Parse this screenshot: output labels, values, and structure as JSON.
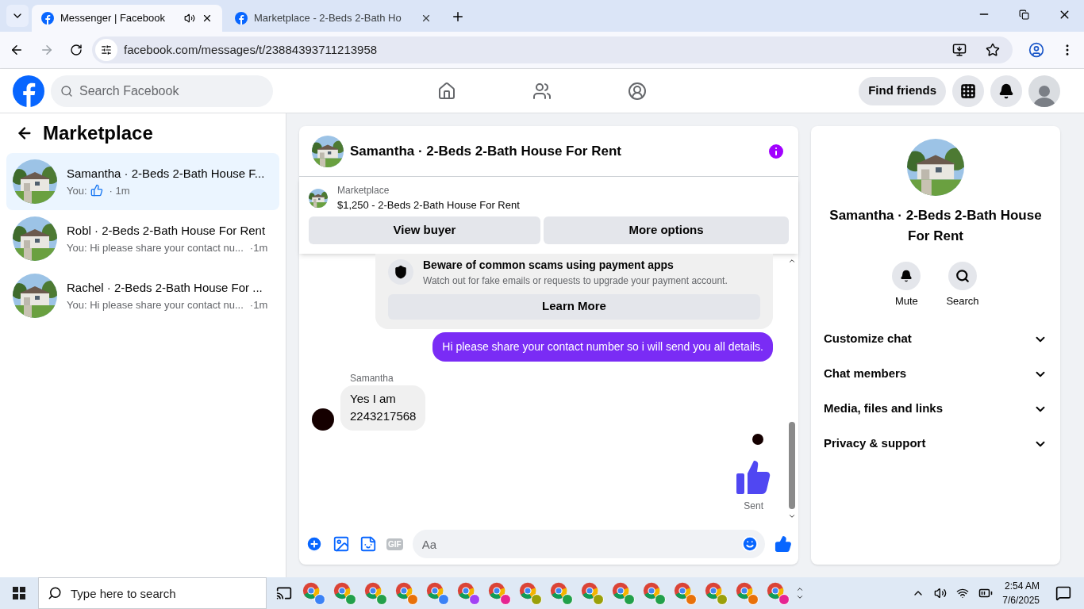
{
  "browser": {
    "tabs": [
      {
        "title": "Messenger | Facebook",
        "selected": true,
        "audio": true
      },
      {
        "title": "Marketplace - 2-Beds 2-Bath Ho",
        "selected": false,
        "audio": false
      }
    ],
    "url": "facebook.com/messages/t/23884393711213958"
  },
  "header": {
    "search_placeholder": "Search Facebook",
    "find_friends": "Find friends"
  },
  "sidebar": {
    "title": "Marketplace",
    "chats": [
      {
        "name": "Samantha · 2-Beds 2-Bath House F...",
        "preview": "You:",
        "time": "· 1m",
        "kind": "like",
        "selected": true
      },
      {
        "name": "Robl · 2-Beds 2-Bath House For Rent",
        "preview": "You: Hi please share your contact nu...",
        "time": "·1m",
        "kind": "text",
        "selected": false
      },
      {
        "name": "Rachel · 2-Beds 2-Bath House For ...",
        "preview": "You: Hi please share your contact nu...",
        "time": "·1m",
        "kind": "text",
        "selected": false
      }
    ]
  },
  "chat": {
    "title": "Samantha · 2-Beds 2-Bath House For Rent",
    "listing": {
      "label": "Marketplace",
      "title": "$1,250 - 2-Beds 2-Bath House For Rent"
    },
    "buttons": [
      "View buyer",
      "More options"
    ],
    "notice": {
      "title": "Beware of common scams using payment apps",
      "text": "Watch out for fake emails or requests to upgrade your payment account.",
      "button": "Learn More"
    },
    "messages": [
      {
        "kind": "sent_text",
        "text": "Hi please share your contact number so i will send you all details."
      },
      {
        "kind": "received_text",
        "sender": "Samantha",
        "text": "Yes I am\n2243217568"
      },
      {
        "kind": "sent_like",
        "status": "Sent"
      }
    ],
    "composer": {
      "placeholder": "Aa",
      "gif": "GIF"
    }
  },
  "details": {
    "title": "Samantha · 2-Beds 2-Bath House For Rent",
    "actions": [
      {
        "kind": "mute",
        "label": "Mute"
      },
      {
        "kind": "search",
        "label": "Search"
      }
    ],
    "sections": [
      "Customize chat",
      "Chat members",
      "Media, files and links",
      "Privacy & support"
    ]
  },
  "taskbar": {
    "search_placeholder": "Type here to search",
    "apps": [
      {
        "color": "#3b82f6"
      },
      {
        "color": "#22a04b"
      },
      {
        "color": "#22a04b"
      },
      {
        "color": "#e8710a"
      },
      {
        "color": "#3b82f6"
      },
      {
        "color": "#a142f4"
      },
      {
        "color": "#e52592"
      },
      {
        "color": "#9aa00a"
      },
      {
        "color": "#22a04b"
      },
      {
        "color": "#9aa00a"
      },
      {
        "color": "#22a04b"
      },
      {
        "color": "#22a04b"
      },
      {
        "color": "#e8710a"
      },
      {
        "color": "#9aa00a"
      },
      {
        "color": "#e8710a"
      },
      {
        "color": "#e52592"
      }
    ],
    "time": "2:54 AM",
    "date": "7/6/2025"
  }
}
